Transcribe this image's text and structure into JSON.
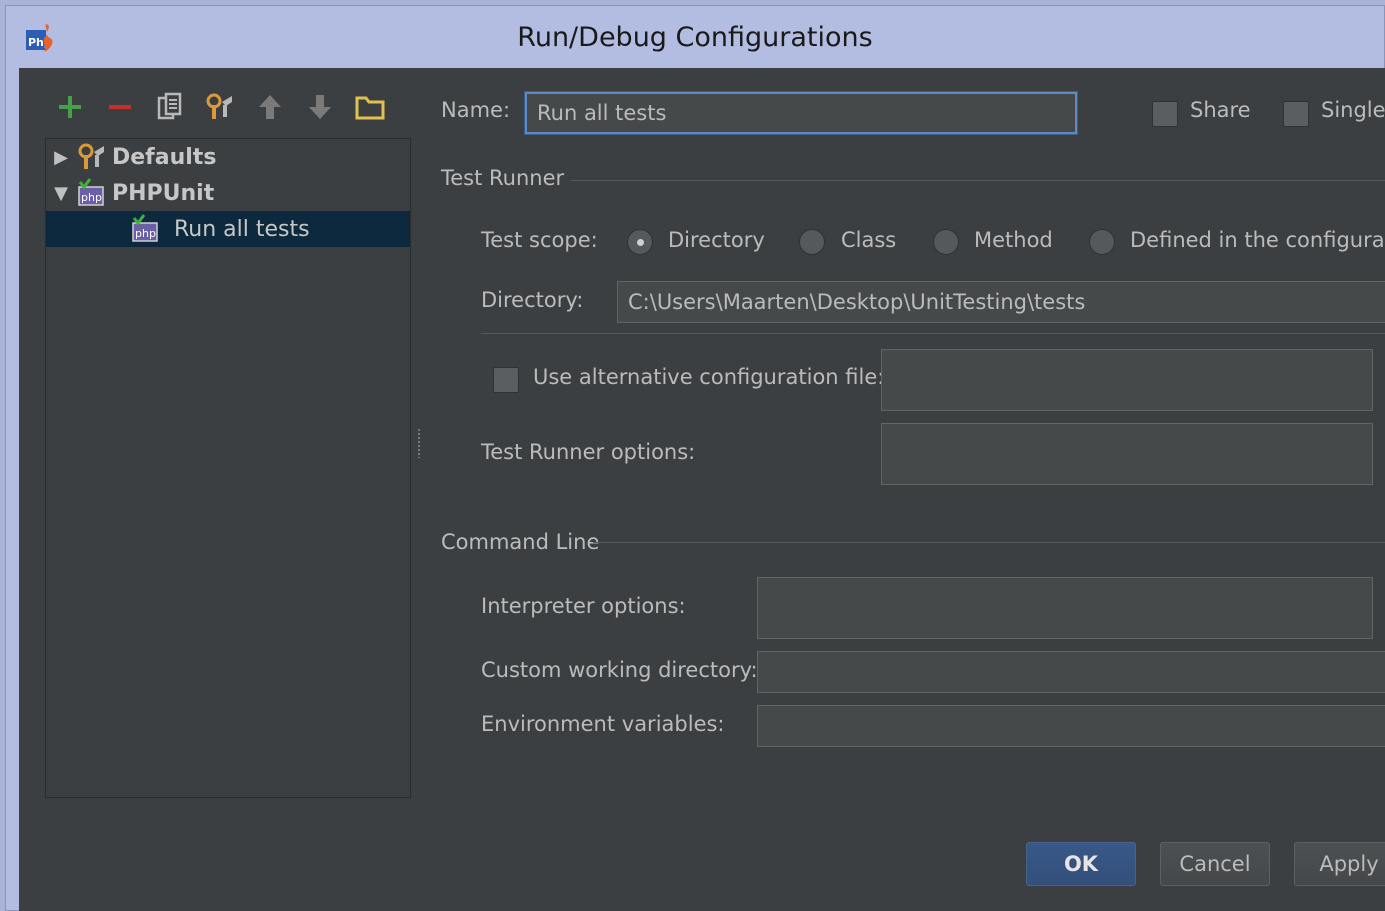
{
  "window": {
    "title": "Run/Debug Configurations"
  },
  "toolbar": {
    "items": [
      {
        "icon": "plus-icon",
        "color": "#45a049"
      },
      {
        "icon": "minus-icon",
        "color": "#c9302c"
      },
      {
        "icon": "copy-icon",
        "color": "#b0b0b0"
      },
      {
        "icon": "wrench-icon",
        "color": "#b0b0b0"
      },
      {
        "icon": "arrow-up-icon",
        "color": "#7a7a7a"
      },
      {
        "icon": "arrow-down-icon",
        "color": "#7a7a7a"
      },
      {
        "icon": "folder-icon",
        "color": "#e0c050"
      }
    ]
  },
  "tree": {
    "items": [
      {
        "label": "Defaults",
        "expanded": false,
        "icon": "wrench-icon"
      },
      {
        "label": "PHPUnit",
        "expanded": true,
        "icon": "php-icon"
      },
      {
        "label": "Run all tests",
        "selected": true,
        "icon": "php-icon"
      }
    ]
  },
  "form": {
    "name_label": "Name:",
    "name_value": "Run all tests",
    "share_label": "Share",
    "single_label": "Single",
    "test_runner_header": "Test Runner",
    "test_scope_label": "Test scope:",
    "scope_options": [
      "Directory",
      "Class",
      "Method",
      "Defined in the configuratio"
    ],
    "scope_selected": "Directory",
    "directory_label": "Directory:",
    "directory_value": "C:\\Users\\Maarten\\Desktop\\UnitTesting\\tests",
    "alt_config_label": "Use alternative configuration file:",
    "alt_config_value": "",
    "runner_options_label": "Test Runner options:",
    "runner_options_value": "",
    "command_line_header": "Command Line",
    "interpreter_options_label": "Interpreter options:",
    "interpreter_options_value": "",
    "working_dir_label": "Custom working directory:",
    "working_dir_value": "",
    "env_vars_label": "Environment variables:",
    "env_vars_value": ""
  },
  "buttons": {
    "ok": "OK",
    "cancel": "Cancel",
    "apply": "Apply"
  }
}
